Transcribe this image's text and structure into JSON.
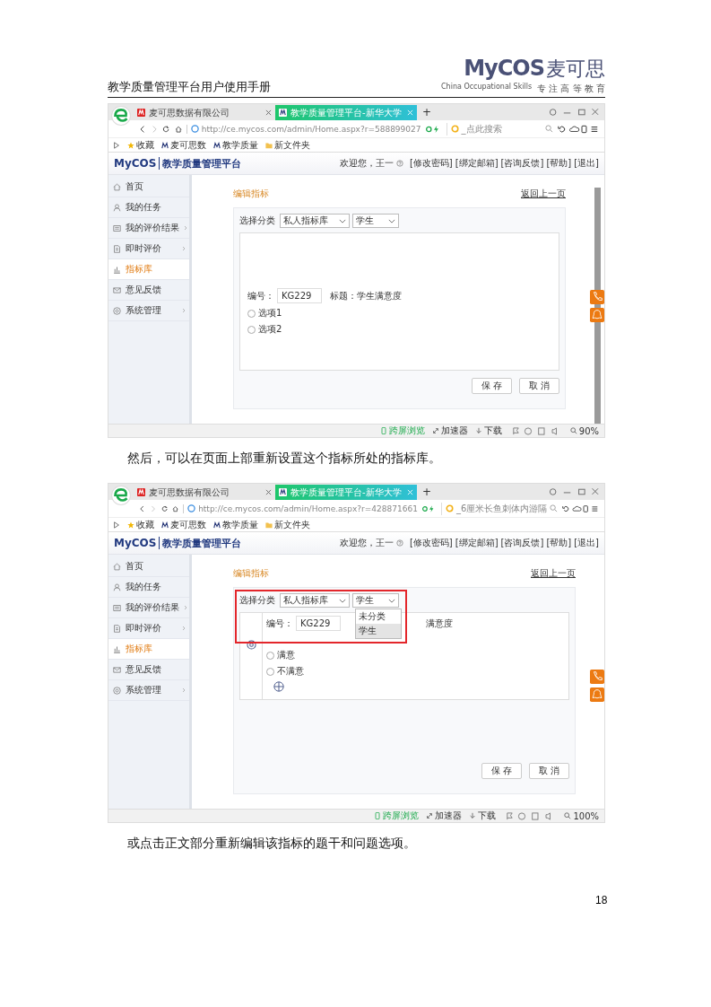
{
  "header": {
    "title": "教学质量管理平台用户使用手册",
    "logo": {
      "mark": "MyCOS",
      "name": "麦可思",
      "tagline": "China Occupational Skills",
      "slogan": "专 注 高 等 教 育"
    }
  },
  "content": [
    {
      "kind": "screenshot",
      "browser": {
        "tabs": [
          {
            "label": "麦可思数据有限公司",
            "selected": false
          },
          {
            "label": "教学质量管理平台-新华大学",
            "selected": true
          }
        ],
        "new_tab": "+",
        "url": "http://ce.mycos.com/admin/Home.aspx?r=588899027",
        "search_placeholder": "_点此搜索",
        "bookmarks": [
          "收藏",
          "麦可思数",
          "教学质量",
          "新文件夹"
        ],
        "status_items": [
          "跨屏浏览",
          "加速器",
          "下载"
        ],
        "zoom": "90%"
      },
      "app": {
        "logo": "MyCOS",
        "title": "教学质量管理平台",
        "welcome": "欢迎您，王一",
        "links": [
          "[修改密码]",
          "[绑定邮箱]",
          "[咨询反馈]",
          "[帮助]",
          "[退出]"
        ],
        "sidebar": [
          {
            "label": "首页",
            "selected": false,
            "expandable": false
          },
          {
            "label": "我的任务",
            "selected": false,
            "expandable": false
          },
          {
            "label": "我的评价结果",
            "selected": false,
            "expandable": true
          },
          {
            "label": "即时评价",
            "selected": false,
            "expandable": true
          },
          {
            "label": "指标库",
            "selected": true,
            "expandable": false
          },
          {
            "label": "意见反馈",
            "selected": false,
            "expandable": false
          },
          {
            "label": "系统管理",
            "selected": false,
            "expandable": true
          }
        ],
        "page_title": "编辑指标",
        "back_link": "返回上一页",
        "category_label": "选择分类",
        "selects": [
          "私人指标库",
          "学生"
        ],
        "editing": false,
        "scrollbar": true,
        "question": {
          "code_label": "编号：",
          "code": "KG229",
          "title": "标题：学生满意度",
          "options": [
            "选项1",
            "选项2"
          ]
        },
        "buttons": [
          "保 存",
          "取 消"
        ]
      }
    },
    {
      "kind": "caption",
      "text": "然后，可以在页面上部重新设置这个指标所处的指标库。"
    },
    {
      "kind": "screenshot",
      "browser": {
        "tabs": [
          {
            "label": "麦可思数据有限公司",
            "selected": false
          },
          {
            "label": "教学质量管理平台-新华大学",
            "selected": true
          }
        ],
        "new_tab": "+",
        "url": "http://ce.mycos.com/admin/Home.aspx?r=428871661",
        "search_placeholder": "_6厘米长鱼刺体内游隔",
        "bookmarks": [
          "收藏",
          "麦可思数",
          "教学质量",
          "新文件夹"
        ],
        "status_items": [
          "跨屏浏览",
          "加速器",
          "下载"
        ],
        "zoom": "100%"
      },
      "app": {
        "logo": "MyCOS",
        "title": "教学质量管理平台",
        "welcome": "欢迎您，王一",
        "links": [
          "[修改密码]",
          "[绑定邮箱]",
          "[咨询反馈]",
          "[帮助]",
          "[退出]"
        ],
        "sidebar": [
          {
            "label": "首页",
            "selected": false,
            "expandable": false
          },
          {
            "label": "我的任务",
            "selected": false,
            "expandable": false
          },
          {
            "label": "我的评价结果",
            "selected": false,
            "expandable": true
          },
          {
            "label": "即时评价",
            "selected": false,
            "expandable": true
          },
          {
            "label": "指标库",
            "selected": true,
            "expandable": false
          },
          {
            "label": "意见反馈",
            "selected": false,
            "expandable": false
          },
          {
            "label": "系统管理",
            "selected": false,
            "expandable": true
          }
        ],
        "page_title": "编辑指标",
        "back_link": "返回上一页",
        "category_label": "选择分类",
        "selects": [
          "私人指标库",
          "学生"
        ],
        "highlight": true,
        "editing": true,
        "dropdown": [
          {
            "label": "未分类",
            "selected": false
          },
          {
            "label": "学生",
            "selected": true
          }
        ],
        "question": {
          "code_label": "编号：",
          "code": "KG229",
          "title": "满意度",
          "options": [
            "满意",
            "不满意"
          ]
        },
        "buttons": [
          "保 存",
          "取 消"
        ]
      }
    },
    {
      "kind": "caption",
      "text": "或点击正文部分重新编辑该指标的题干和问题选项。"
    }
  ],
  "page_number": "18"
}
